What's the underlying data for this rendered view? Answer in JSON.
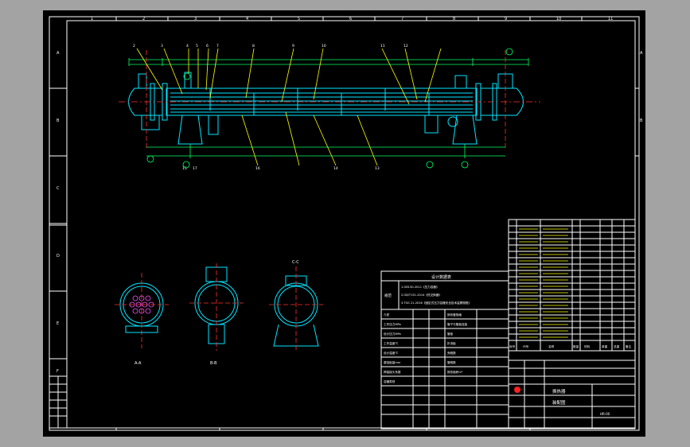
{
  "sheet": {
    "frame_color": "#ffffff",
    "bg": "#000000",
    "row_markers": [
      "A",
      "B",
      "C",
      "D",
      "E",
      "F"
    ],
    "col_markers": [
      "1",
      "2",
      "3",
      "4",
      "5",
      "6",
      "7",
      "8",
      "9",
      "10",
      "11"
    ]
  },
  "callouts_top": [
    "2",
    "3",
    "4",
    "5",
    "6",
    "7",
    "8",
    "9",
    "10",
    "11",
    "12"
  ],
  "callouts_bottom": [
    "15",
    "17",
    "16",
    "14",
    "13"
  ],
  "section_labels": [
    "A-A",
    "B-B",
    "C-C"
  ],
  "design_table": {
    "title": "设计数据表",
    "spec_label": "规范",
    "spec_lines": [
      "1.GB150-2011《压力容器》",
      "2.GB/T151-2014《热交换器》",
      "3.TSG 21-2016《固定式压力容器安全技术监察规程》"
    ],
    "rows": [
      [
        "介质",
        "",
        "换热管规格"
      ],
      [
        "工作压力MPa",
        "",
        "管子与管板连接"
      ],
      [
        "设计压力MPa",
        "",
        "管板"
      ],
      [
        "工作温度℃",
        "",
        "折流板"
      ],
      [
        "设计温度℃",
        "",
        "壳程数"
      ],
      [
        "腐蚀裕量mm",
        "",
        "管程数"
      ],
      [
        "焊接接头系数",
        "",
        "换热面积m²"
      ],
      [
        "容器类别",
        "",
        ""
      ]
    ]
  },
  "parts_header": [
    "序号",
    "代号",
    "名称",
    "数量",
    "材料",
    "单重",
    "总重",
    "备注"
  ],
  "title_block": {
    "company": "换热器",
    "drawing_title": "装配图",
    "drawing_no": "HR-00"
  },
  "colors": {
    "equipment": "#00e5ff",
    "leader": "#ffff00",
    "centerline": "#ff3030",
    "dimension": "#00ff66"
  }
}
